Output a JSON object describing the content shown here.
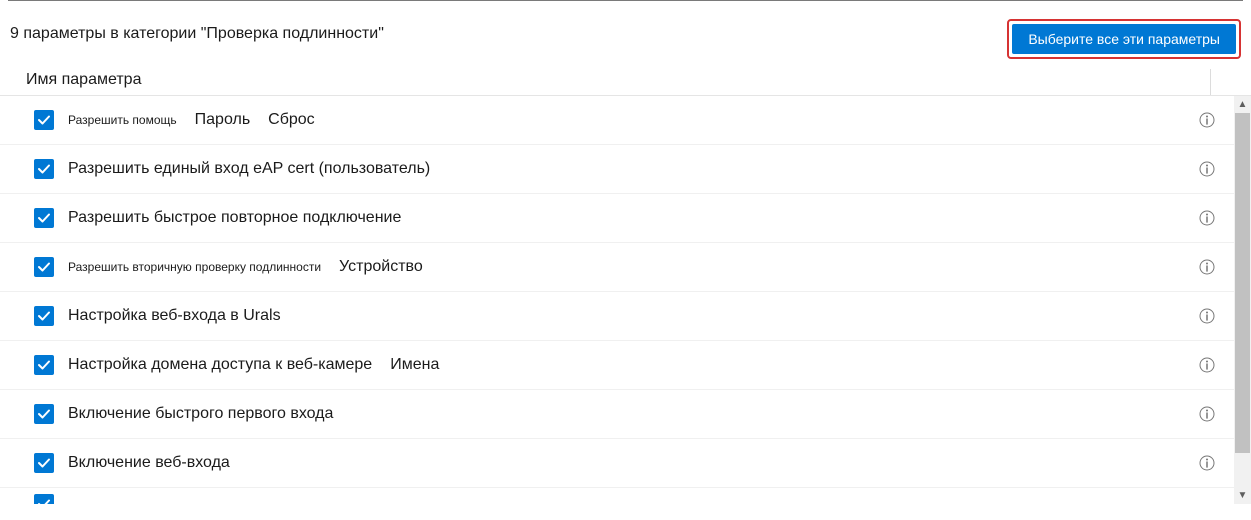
{
  "header": {
    "count": "9",
    "category_text": "параметры в категории \"Проверка подлинности\"",
    "select_all": "Выберите все эти параметры"
  },
  "table": {
    "column_name": "Имя параметра"
  },
  "rows": [
    {
      "parts": [
        {
          "text": "Разрешить помощь",
          "cls": "small"
        },
        {
          "text": "Пароль",
          "cls": "reg"
        },
        {
          "text": "Сброс",
          "cls": "reg"
        }
      ]
    },
    {
      "parts": [
        {
          "text": "Разрешить единый вход eAP cert (пользователь)",
          "cls": "reg"
        }
      ]
    },
    {
      "parts": [
        {
          "text": "Разрешить быстрое повторное подключение",
          "cls": "reg"
        }
      ]
    },
    {
      "parts": [
        {
          "text": "Разрешить вторичную проверку подлинности",
          "cls": "small"
        },
        {
          "text": "Устройство",
          "cls": "reg"
        }
      ]
    },
    {
      "parts": [
        {
          "text": "Настройка веб-входа в Urals",
          "cls": "reg"
        }
      ]
    },
    {
      "parts": [
        {
          "text": "Настройка домена доступа к веб-камере",
          "cls": "reg"
        },
        {
          "text": "Имена",
          "cls": "reg"
        }
      ]
    },
    {
      "parts": [
        {
          "text": "Включение быстрого первого входа",
          "cls": "reg"
        }
      ]
    },
    {
      "parts": [
        {
          "text": "Включение веб-входа",
          "cls": "reg"
        }
      ]
    }
  ]
}
